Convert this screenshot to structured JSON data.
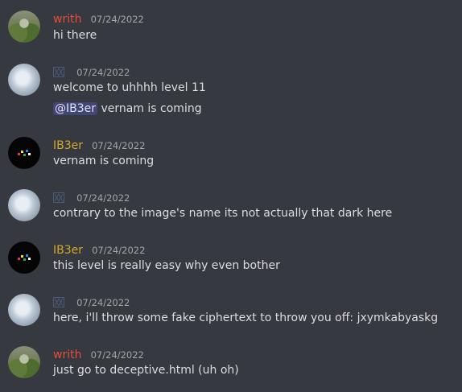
{
  "messages": [
    {
      "author": "writh",
      "timestamp": "07/24/2022",
      "lines": [
        "hi there"
      ]
    },
    {
      "author": "",
      "author_icon": "unknown-glyph-icon",
      "timestamp": "07/24/2022",
      "lines": [
        "welcome to uhhhh level 11"
      ],
      "mention_line": {
        "mention": "@IB3er",
        "text": " vernam is coming"
      }
    },
    {
      "author": "IB3er",
      "timestamp": "07/24/2022",
      "lines": [
        "vernam is coming"
      ]
    },
    {
      "author": "",
      "author_icon": "unknown-glyph-icon",
      "timestamp": "07/24/2022",
      "lines": [
        "contrary to the image's name its not actually that dark here"
      ]
    },
    {
      "author": "IB3er",
      "timestamp": "07/24/2022",
      "lines": [
        "this level is really easy why even bother"
      ]
    },
    {
      "author": "",
      "author_icon": "unknown-glyph-icon",
      "timestamp": "07/24/2022",
      "lines": [
        "here, i'll throw some fake ciphertext to throw you off: jxymkabyaskg"
      ]
    },
    {
      "author": "writh",
      "timestamp": "07/24/2022",
      "lines": [
        "just go to deceptive.html (uh oh)"
      ]
    }
  ],
  "colors": {
    "background": "#36393f",
    "writh": "#e74c3c",
    "ib3er": "#d4a82c",
    "mention_bg": "#414675"
  }
}
